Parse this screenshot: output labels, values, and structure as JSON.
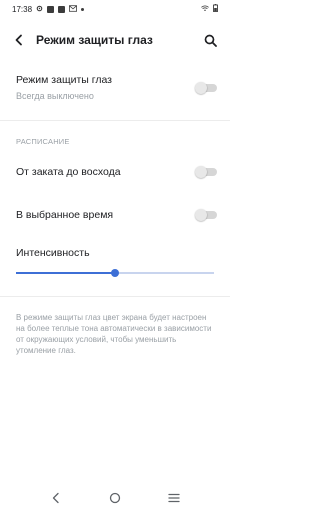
{
  "status_bar": {
    "time": "17:38",
    "icons": [
      "gear-icon",
      "vk-icon",
      "app-icon",
      "gmail-icon",
      "dot-icon"
    ],
    "right_icons": [
      "wifi-icon",
      "battery-icon"
    ]
  },
  "app_bar": {
    "back_icon": "back-arrow-icon",
    "title": "Режим защиты глаз",
    "search_icon": "search-icon"
  },
  "main_setting": {
    "label": "Режим защиты глаз",
    "subtitle": "Всегда выключено",
    "enabled": false
  },
  "schedule": {
    "header": "РАСПИСАНИЕ",
    "items": [
      {
        "label": "От заката до восхода",
        "enabled": false
      },
      {
        "label": "В выбранное время",
        "enabled": false
      }
    ]
  },
  "intensity": {
    "label": "Интенсивность",
    "value": 0.5
  },
  "description": "В режиме защиты глаз цвет экрана будет настроен на более теплые тона автоматически в зависимости от окружающих условий, чтобы уменьшить утомление глаз.",
  "colors": {
    "accent": "#3d6fd6",
    "track": "#c8d4ee",
    "toggle_off": "#d6d6d6",
    "secondary_text": "#9aa0a6"
  },
  "nav_bar": {
    "icons": [
      "nav-back-icon",
      "nav-home-icon",
      "nav-recents-icon"
    ]
  }
}
